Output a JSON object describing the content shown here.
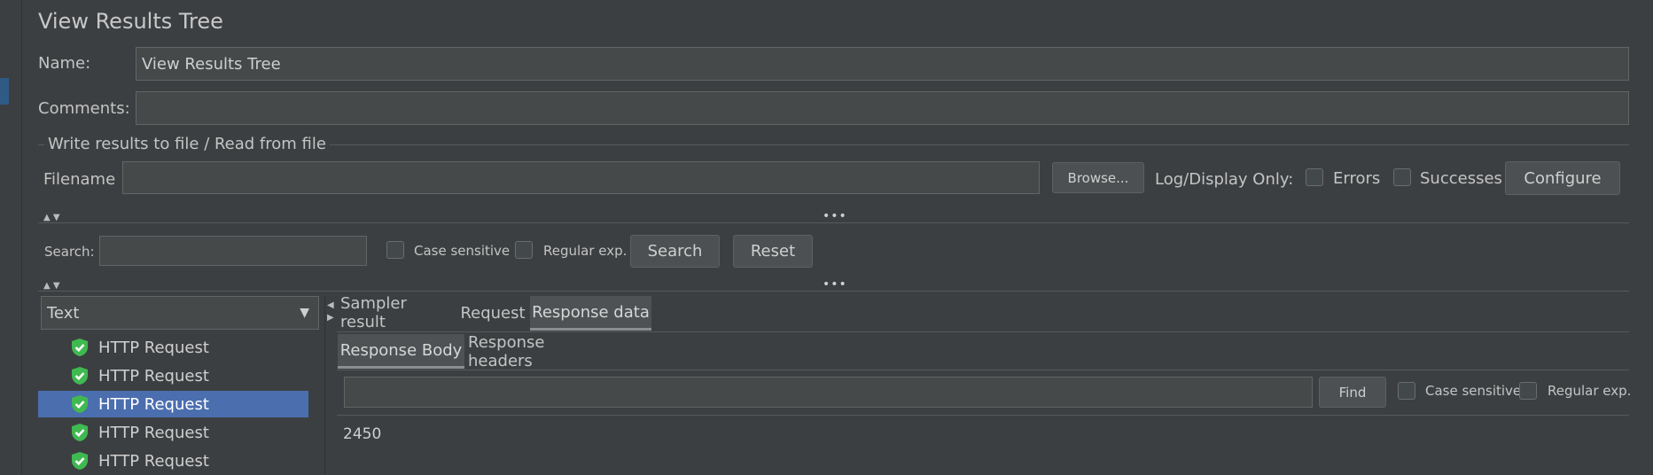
{
  "panel": {
    "title": "View Results Tree"
  },
  "name_field": {
    "label": "Name:",
    "value": "View Results Tree"
  },
  "comments_field": {
    "label": "Comments:",
    "value": ""
  },
  "file_section": {
    "legend": "Write results to file / Read from file",
    "filename_label": "Filename",
    "filename_value": "",
    "browse_label": "Browse...",
    "log_display_label": "Log/Display Only:",
    "errors_label": "Errors",
    "successes_label": "Successes",
    "configure_label": "Configure"
  },
  "search_bar": {
    "label": "Search:",
    "value": "",
    "case_sensitive_label": "Case sensitive",
    "regex_label": "Regular exp.",
    "search_label": "Search",
    "reset_label": "Reset"
  },
  "renderer": {
    "selected": "Text"
  },
  "tree": {
    "items": [
      {
        "label": "HTTP Request",
        "status": "success"
      },
      {
        "label": "HTTP Request",
        "status": "success"
      },
      {
        "label": "HTTP Request",
        "status": "success",
        "selected": true
      },
      {
        "label": "HTTP Request",
        "status": "success"
      },
      {
        "label": "HTTP Request",
        "status": "success"
      }
    ]
  },
  "result_tabs": {
    "sampler_result": "Sampler result",
    "request": "Request",
    "response_data": "Response data",
    "active": "Response data"
  },
  "response_tabs": {
    "body": "Response Body",
    "headers": "Response headers",
    "active": "Response Body"
  },
  "find_bar": {
    "value": "",
    "find_label": "Find",
    "case_sensitive_label": "Case sensitive",
    "regex_label": "Regular exp."
  },
  "response_body": {
    "text": "2450"
  },
  "colors": {
    "background": "#3c3f41",
    "selection": "#4b6eaf",
    "success_icon": "#3fb950"
  }
}
